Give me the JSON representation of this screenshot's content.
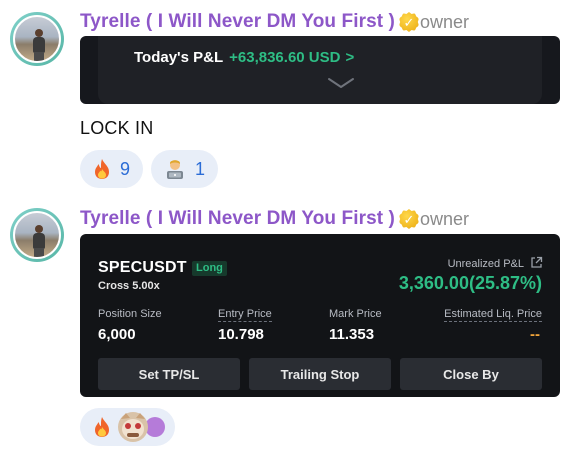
{
  "messages": [
    {
      "author": "Tyrelle ( I Will Never DM You First )",
      "role": "owner",
      "embed": {
        "label": "Today's P&L",
        "value": "+63,836.60 USD",
        "chevron": ">"
      },
      "text": "LOCK IN",
      "reactions": [
        {
          "icon": "fire-icon",
          "count": "9"
        },
        {
          "icon": "technologist-icon",
          "count": "1"
        }
      ]
    },
    {
      "author": "Tyrelle ( I Will Never DM You First )",
      "role": "owner",
      "card": {
        "symbol": "SPECUSDT",
        "side": "Long",
        "margin": "Cross 5.00x",
        "unrealized_label": "Unrealized P&L",
        "unrealized_value": "3,360.00(25.87%)",
        "stats": [
          {
            "label": "Position Size",
            "value": "6,000"
          },
          {
            "label": "Entry Price",
            "value": "10.798"
          },
          {
            "label": "Mark Price",
            "value": "11.353"
          },
          {
            "label": "Estimated Liq. Price",
            "value": "--"
          }
        ],
        "buttons": [
          "Set TP/SL",
          "Trailing Stop",
          "Close By"
        ]
      },
      "reactions": [
        {
          "icon": "fire-icon"
        },
        {
          "icon": "sticker-icon"
        }
      ]
    }
  ],
  "colors": {
    "author": "#8d57c8",
    "profit": "#2ebd85",
    "reaction_count": "#2b6cd6",
    "liq": "#f0a43a"
  }
}
